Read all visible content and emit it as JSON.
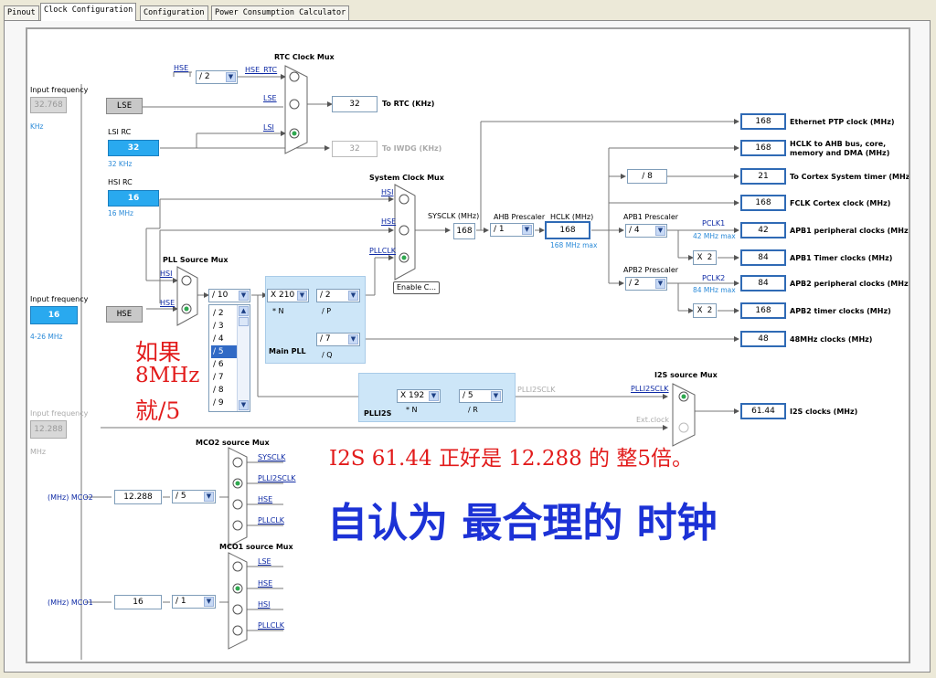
{
  "tabs": [
    {
      "label": "Pinout"
    },
    {
      "label": "Clock Configuration"
    },
    {
      "label": "Configuration"
    },
    {
      "label": "Power Consumption Calculator"
    }
  ],
  "inputs": {
    "lse": {
      "caption": "Input frequency",
      "value": "32.768",
      "unit": "KHz",
      "name": "LSE"
    },
    "lsi": {
      "caption": "LSI RC",
      "value": "32",
      "unit": "32 KHz"
    },
    "hsi": {
      "caption": "HSI RC",
      "value": "16",
      "unit": "16 MHz"
    },
    "hse": {
      "caption": "Input frequency",
      "value": "16",
      "unit": "4-26 MHz",
      "name": "HSE"
    },
    "ext": {
      "caption": "Input frequency",
      "value": "12.288",
      "unit": "MHz"
    }
  },
  "rtc_mux": {
    "title": "RTC Clock Mux",
    "hse_label": "HSE",
    "hse_rtc": "HSE_RTC",
    "lse": "LSE",
    "lsi": "LSI",
    "prescaler": "/ 2"
  },
  "to_rtc": {
    "value": "32",
    "label": "To RTC (KHz)"
  },
  "to_iwdg": {
    "value": "32",
    "label": "To IWDG (KHz)"
  },
  "sys_mux": {
    "title": "System Clock Mux",
    "hsi": "HSI",
    "hse": "HSE",
    "pllclk": "PLLCLK"
  },
  "sysclk": {
    "label": "SYSCLK (MHz)",
    "value": "168"
  },
  "ahb": {
    "label": "AHB Prescaler",
    "value": "/ 1"
  },
  "hclk": {
    "label": "HCLK (MHz)",
    "value": "168",
    "max": "168 MHz max"
  },
  "enable_btn": "Enable C...",
  "pll_src": {
    "title": "PLL Source Mux",
    "hsi": "HSI",
    "hse": "HSE"
  },
  "pll": {
    "m": "/ 10",
    "n": "X 210",
    "n_label": "* N",
    "p": "/ 2",
    "p_label": "/ P",
    "q": "/ 7",
    "q_label": "/ Q",
    "title": "Main PLL"
  },
  "m_list": [
    "/ 2",
    "/ 3",
    "/ 4",
    "/ 5",
    "/ 6",
    "/ 7",
    "/ 8",
    "/ 9"
  ],
  "plli2s": {
    "title": "PLLI2S",
    "n": "X 192",
    "n_label": "* N",
    "r": "/ 5",
    "r_label": "/ R",
    "out": "PLLI2SCLK"
  },
  "i2s_mux": {
    "title": "I2S source Mux",
    "plli2sclk": "PLLI2SCLK",
    "ext": "Ext.clock"
  },
  "apb1": {
    "label": "APB1 Prescaler",
    "value": "/ 4",
    "pclk": "PCLK1",
    "max": "42 MHz max",
    "x2": "X 2"
  },
  "apb2": {
    "label": "APB2 Prescaler",
    "value": "/ 2",
    "pclk": "PCLK2",
    "max": "84 MHz max",
    "x2": "X 2"
  },
  "cortex_div": "/ 8",
  "outputs": [
    {
      "value": "168",
      "label": "Ethernet PTP clock (MHz)"
    },
    {
      "value": "168",
      "label": "HCLK to AHB bus, core,"
    },
    {
      "value": "21",
      "label": "To Cortex System timer (MHz)"
    },
    {
      "value": "168",
      "label": "FCLK Cortex clock (MHz)"
    },
    {
      "value": "42",
      "label": "APB1 peripheral clocks (MHz)"
    },
    {
      "value": "84",
      "label": "APB1 Timer clocks (MHz)"
    },
    {
      "value": "84",
      "label": "APB2 peripheral clocks (MHz)"
    },
    {
      "value": "168",
      "label": "APB2 timer clocks (MHz)"
    },
    {
      "value": "48",
      "label": "48MHz clocks (MHz)"
    },
    {
      "value": "61.44",
      "label": "I2S clocks (MHz)"
    }
  ],
  "hclk_label2": "memory and DMA (MHz)",
  "mco2": {
    "title": "MCO2 source Mux",
    "opts": [
      "SYSCLK",
      "PLLI2SCLK",
      "HSE",
      "PLLCLK"
    ],
    "div": "/ 5",
    "value": "12.288",
    "label": "(MHz) MCO2"
  },
  "mco1": {
    "title": "MCO1 source Mux",
    "opts": [
      "LSE",
      "HSE",
      "HSI",
      "PLLCLK"
    ],
    "div": "/ 1",
    "value": "16",
    "label": "(MHz) MCO1"
  },
  "annotations": {
    "line1": "如果",
    "line2": "8MHz",
    "line3": "就/5",
    "i2s_note": "I2S 61.44 正好是 12.288 的 整5倍。",
    "big": "自认为 最合理的 时钟"
  }
}
